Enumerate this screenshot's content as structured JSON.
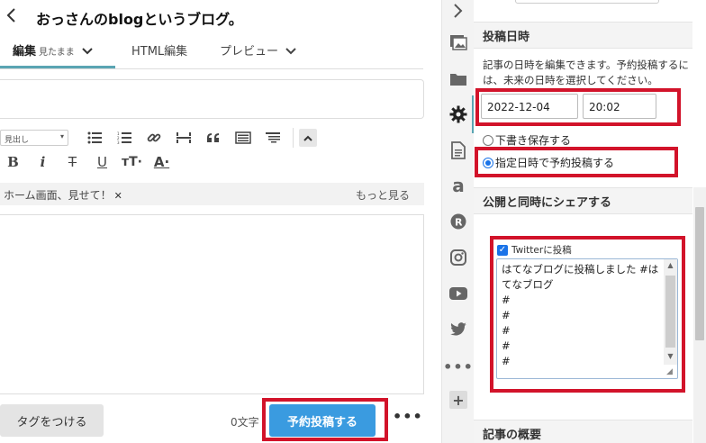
{
  "editor": {
    "back_icon": "chevron-left-icon",
    "blog_title": "おっさんのblogというブログ。",
    "tabs": {
      "edit": "編集",
      "edit_mode": "見たまま",
      "html": "HTML編集",
      "preview": "プレビュー"
    },
    "toolbar": {
      "heading_select": "見出し"
    },
    "tag_bar": {
      "text": "ホーム画面、見せて！",
      "more": "もっと見る"
    },
    "footer": {
      "tag_button": "タグをつける",
      "char_count": "0文字",
      "schedule_button": "予約投稿する",
      "more_menu": "•••"
    }
  },
  "sidebar": {
    "items": [
      "chevron-right-icon",
      "image-icon",
      "folder-icon",
      "gear-icon",
      "document-icon",
      "amazon-icon",
      "rakuten-icon",
      "instagram-icon",
      "youtube-icon",
      "twitter-icon",
      "more-icon"
    ],
    "add_label": "+",
    "accent": "#5aa5b3"
  },
  "panel": {
    "post_date": {
      "heading": "投稿日時",
      "description": "記事の日時を編集できます。予約投稿するには、未来の日時を選択してください。",
      "date": "2022-12-04",
      "time": "20:02",
      "options": [
        {
          "label": "下書き保存する",
          "selected": false
        },
        {
          "label": "指定日時で予約投稿する",
          "selected": true
        }
      ]
    },
    "share": {
      "heading": "公開と同時にシェアする",
      "twitter_label": "Twitterに投稿",
      "twitter_checked": true,
      "tweet_text": "はてなブログに投稿しました #はてなブログ\n#\n#\n#\n#\n#"
    },
    "summary": {
      "heading": "記事の概要"
    }
  },
  "colors": {
    "primary_button": "#3a9be0",
    "annotation": "#d2132a",
    "active_tab": "#5aa5b3"
  }
}
